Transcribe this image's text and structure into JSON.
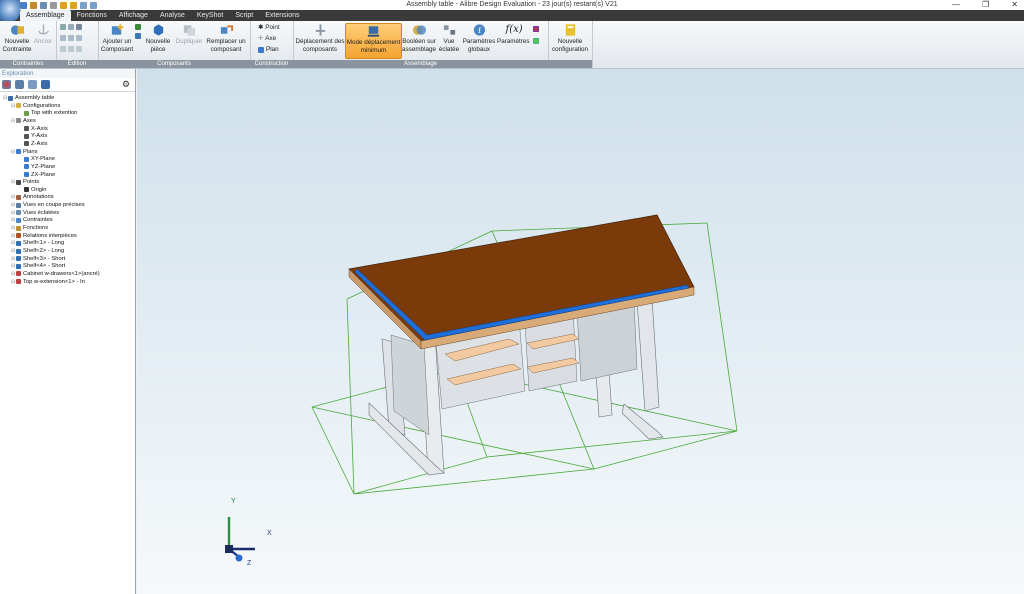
{
  "window": {
    "title": "Assembly table - Alibre Design  Evaluation - 23 jour(s) restant(s) V21",
    "controls": [
      "—",
      "❐",
      "✕"
    ]
  },
  "menu": {
    "tabs": [
      "Assemblage",
      "Fonctions",
      "Affichage",
      "Analyse",
      "KeyShot",
      "Script",
      "Extensions"
    ],
    "active": "Assemblage"
  },
  "ribbon": {
    "contraintes": {
      "label": "Contraintes",
      "nouvelle_contrainte": "Nouvelle Contrainte",
      "ancrer": "Ancrer"
    },
    "edition": {
      "label": "Édition"
    },
    "composants": {
      "label": "Composants",
      "ajouter": "Ajouter un Composant",
      "nouvelle_piece": "Nouvelle pièce",
      "dupliquer": "Dupliquer",
      "remplacer": "Remplacer un composant"
    },
    "construction": {
      "label": "Construction",
      "point": "Point",
      "axe": "Axe",
      "plan": "Plan"
    },
    "assemblage": {
      "label": "Assemblage",
      "deplacement": "Déplacement des composants",
      "mode_min": "Mode déplacement minimum",
      "booleen": "Booléen sur assemblage",
      "vue_eclatee": "Vue éclatée",
      "param_globaux": "Paramètres globaux",
      "parametres": "Paramètres",
      "fx": "f(x)"
    },
    "configuration": {
      "nouvelle": "Nouvelle configuration"
    }
  },
  "explorer": {
    "title": "Exploration",
    "tree": [
      {
        "label": "Assembly table",
        "depth": 0,
        "icon": "assembly-icon"
      },
      {
        "label": "Configurations",
        "depth": 1,
        "icon": "folder-icon"
      },
      {
        "label": "Top with extention",
        "depth": 2,
        "icon": "check-icon"
      },
      {
        "label": "Axes",
        "depth": 1,
        "icon": "axes-icon"
      },
      {
        "label": "X-Axis",
        "depth": 2,
        "icon": "axis-icon"
      },
      {
        "label": "Y-Axis",
        "depth": 2,
        "icon": "axis-icon"
      },
      {
        "label": "Z-Axis",
        "depth": 2,
        "icon": "axis-icon"
      },
      {
        "label": "Plans",
        "depth": 1,
        "icon": "planes-icon"
      },
      {
        "label": "XY-Plane",
        "depth": 2,
        "icon": "plane-icon"
      },
      {
        "label": "YZ-Plane",
        "depth": 2,
        "icon": "plane-icon"
      },
      {
        "label": "ZX-Plane",
        "depth": 2,
        "icon": "plane-icon"
      },
      {
        "label": "Points",
        "depth": 1,
        "icon": "points-icon"
      },
      {
        "label": "Origin",
        "depth": 2,
        "icon": "point-icon"
      },
      {
        "label": "Annotations",
        "depth": 1,
        "icon": "annotation-icon"
      },
      {
        "label": "Vues en coupe précises",
        "depth": 1,
        "icon": "section-icon"
      },
      {
        "label": "Vues éclatées",
        "depth": 1,
        "icon": "exploded-icon"
      },
      {
        "label": "Contraintes",
        "depth": 1,
        "icon": "constraint-icon"
      },
      {
        "label": "Fonctions",
        "depth": 1,
        "icon": "function-icon"
      },
      {
        "label": "Relations interpièces",
        "depth": 1,
        "icon": "relation-icon"
      },
      {
        "label": "Shelf<1> - Long",
        "depth": 1,
        "icon": "part-icon"
      },
      {
        "label": "Shelf<2> - Long",
        "depth": 1,
        "icon": "part-icon"
      },
      {
        "label": "Shelf<3> - Short",
        "depth": 1,
        "icon": "part-icon"
      },
      {
        "label": "Shelf<4> - Short",
        "depth": 1,
        "icon": "part-icon"
      },
      {
        "label": "Cabinet w-drawers<1>(ancré)",
        "depth": 1,
        "icon": "subassembly-icon"
      },
      {
        "label": "Top w-extension<1> - In",
        "depth": 1,
        "icon": "subassembly-icon"
      }
    ]
  },
  "triad": {
    "x": "X",
    "y": "Y",
    "z": "Z"
  },
  "colors": {
    "menubar": "#3a3a3a",
    "highlight": "#f4a330",
    "tabletop": "#7a3a0a",
    "edge_strip": "#1e6fd9",
    "frame": "#d9dde2",
    "shelf": "#f2c9a0",
    "bbox": "#49a83a"
  }
}
